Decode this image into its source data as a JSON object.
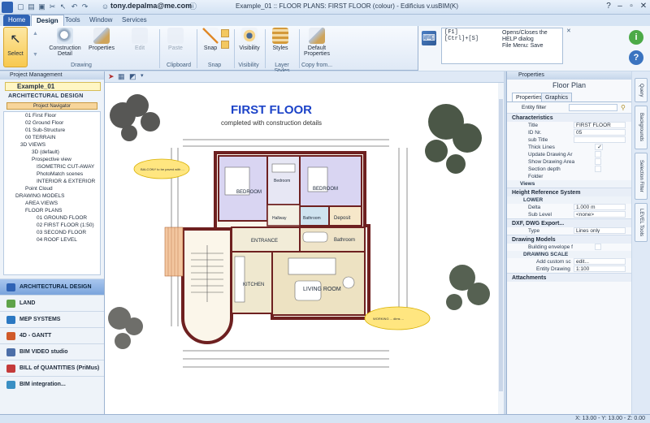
{
  "titlebar": {
    "user": "tony.depalma@me.com",
    "document": "Example_01 :: FLOOR PLANS: FIRST FLOOR (colour) - Edificius v.usBIM(K)"
  },
  "tabs": [
    "Home",
    "Design",
    "Tools",
    "Window",
    "Services"
  ],
  "ribbon": {
    "select": "Select",
    "construction_detail": "Construction Detail",
    "properties": "Properties",
    "group_drawing": "Drawing",
    "edit": "Edit",
    "paste": "Paste",
    "group_clipboard": "Clipboard",
    "snap": "Snap",
    "group_snap": "Snap",
    "visibility": "Visibility",
    "group_visibility": "Visibility",
    "styles": "Styles",
    "group_layer_styles": "Layer Styles",
    "default_properties": "Default Properties",
    "group_copy_from": "Copy from..."
  },
  "help": {
    "keys": "[F1]\n[Ctrl]+[S]",
    "line1": "Opens/Closes the HELP dialog",
    "line2": "File Menu: Save"
  },
  "left": {
    "panel_title": "Project Management",
    "file_tab": "Example_01",
    "section": "ARCHITECTURAL DESIGN",
    "navigator": "Project Navigator",
    "tree": [
      "01 First Floor",
      "02 Ground Floor",
      "01 Sub-Structure",
      "00 TERRAIN",
      "3D VIEWS",
      "3D (default)",
      "Prospective view",
      "ISOMETRIC CUT-AWAY",
      "PhotoMatch scenes",
      "INTERIOR & EXTERIOR",
      "Point Cloud",
      "DRAWING MODELS",
      "AREA VIEWS",
      "FLOOR PLANS",
      "01 GROUND FLOOR",
      "02 FIRST FLOOR (1:50)",
      "03 SECOND FLOOR",
      "04 ROOF LEVEL"
    ],
    "accordion": [
      "ARCHITECTURAL DESIGN",
      "LAND",
      "MEP SYSTEMS",
      "4D - GANTT",
      "BIM VIDEO studio",
      "BILL of QUANTITIES (PriMus)",
      "BIM integration..."
    ]
  },
  "drawing": {
    "title": "FIRST FLOOR",
    "subtitle": "completed with construction details",
    "rooms": [
      "BEDROOM",
      "Bedroom",
      "BEDROOM",
      "Bathroom",
      "Bathroom",
      "Deposit",
      "Hallway",
      "ENTRANCE",
      "KITCHEN",
      "LIVING ROOM"
    ],
    "note1": "BALCONY to be paved with ...",
    "note2": "WORKING ... dims ..."
  },
  "properties": {
    "panel_title": "Properties",
    "heading": "Floor Plan",
    "tab1": "Properties",
    "tab2": "Graphics",
    "entity_filter_label": "Entity filter",
    "characteristics": "Characteristics",
    "rows": [
      {
        "k": "Title",
        "v": "FIRST FLOOR (colour)"
      },
      {
        "k": "ID Nr.",
        "v": "05"
      },
      {
        "k": "sub Title",
        "v": ""
      },
      {
        "k": "Thick Lines",
        "v": ""
      },
      {
        "k": "Update Drawing Ar",
        "v": ""
      },
      {
        "k": "Show Drawing Area",
        "v": ""
      },
      {
        "k": "Section depth",
        "v": ""
      },
      {
        "k": "Folder",
        "v": ""
      }
    ],
    "views": "Views",
    "height_ref": "Height Reference System",
    "lower": "LOWER",
    "delta_k": "Delta",
    "delta_v": "1.000 m",
    "sublevel_k": "Sub Level",
    "sublevel_v": "<none>",
    "dxf": "DXF, DWG Export...",
    "type_k": "Type",
    "type_v": "Lines only",
    "drawing_models": "Drawing Models",
    "building_env_k": "Building envelope f",
    "drawing_scale": "DRAWING SCALE",
    "add_custom_k": "Add custom sc",
    "add_custom_v": "edit...",
    "entity_drawing_k": "Entity Drawing",
    "entity_drawing_v": "1:100",
    "attachments": "Attachments"
  },
  "side_tabs": [
    "Query",
    "Backgrounds",
    "Selection Filter",
    "LEVEL Tools"
  ],
  "status": {
    "coord": "X: 13.00 - Y: 13.00 - Z: 0.00"
  }
}
